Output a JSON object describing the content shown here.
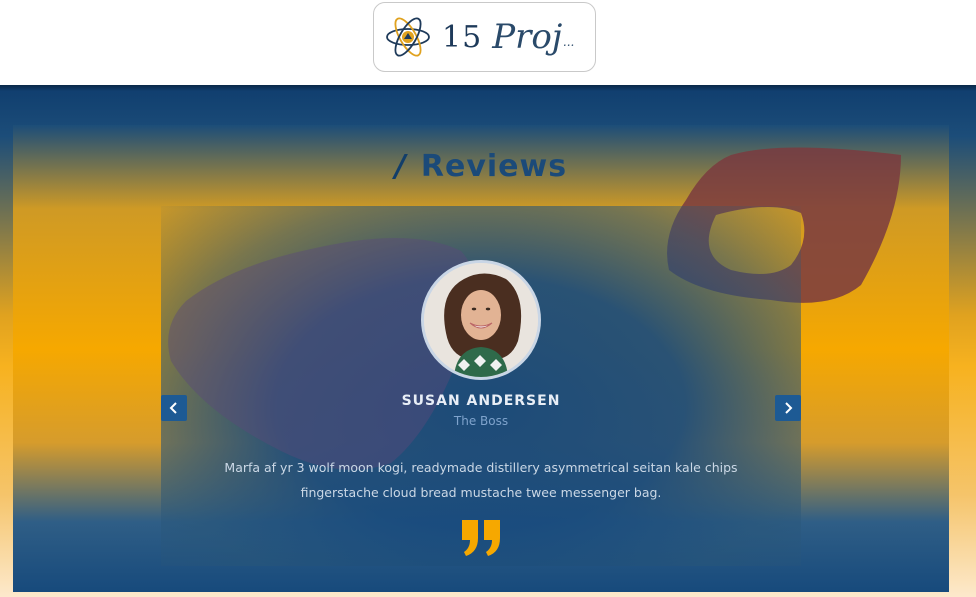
{
  "header": {
    "logo": {
      "number": "15",
      "word": "Proj",
      "suffix": "...",
      "icon": "atom-icon"
    }
  },
  "section": {
    "title_slash": "/",
    "title": "Reviews"
  },
  "review": {
    "name": "SUSAN ANDERSEN",
    "role": "The Boss",
    "text": "Marfa af yr 3 wolf moon kogi, readymade distillery asymmetrical seitan kale chips fingerstache cloud bread mustache twee messenger bag.",
    "quote_icon": "quote-right-icon",
    "avatar": "avatar-photo"
  },
  "nav": {
    "prev_icon": "chevron-left-icon",
    "next_icon": "chevron-right-icon"
  },
  "colors": {
    "accent_orange": "#f6a800",
    "brand_blue": "#1b4a79",
    "button_blue": "#1d5a94"
  }
}
